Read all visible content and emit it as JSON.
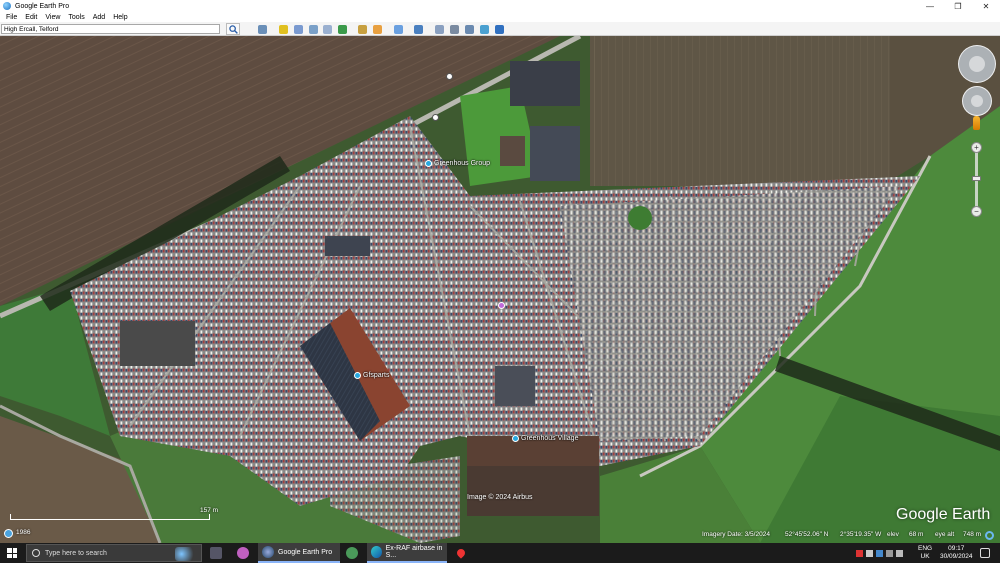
{
  "window": {
    "title": "Google Earth Pro",
    "controls": {
      "minimize": "—",
      "maximize": "❐",
      "close": "✕"
    }
  },
  "menu": [
    "File",
    "Edit",
    "View",
    "Tools",
    "Add",
    "Help"
  ],
  "search": {
    "value": "High Ercall, Telford"
  },
  "toolbar": {
    "icons": [
      "sidebar-icon",
      "placemark-icon",
      "polygon-icon",
      "path-icon",
      "image-overlay-icon",
      "record-tour-icon",
      "historical-imagery-icon",
      "sunlight-icon",
      "planets-icon",
      "ruler-icon",
      "email-icon",
      "print-icon",
      "save-image-icon",
      "view-in-maps-icon",
      "earth-icon"
    ],
    "colors": [
      "#6a8fb8",
      "#e0c020",
      "#7a9ad0",
      "#7aa0c8",
      "#9ab0d0",
      "#3a9a4a",
      "#c7a040",
      "#e8a040",
      "#6aa0e0",
      "#4a80c0",
      "#8aa0c0",
      "#7a8aa0",
      "#6a8ab0",
      "#4aa0d0",
      "#3070c0"
    ]
  },
  "map": {
    "places": {
      "greenhous_group": "Greenhous Group",
      "gfsparts": "Gfsparts",
      "greenhous_village": "Greenhous Village"
    },
    "scale": "157 m",
    "history_year": "1986",
    "copyright": "Image © 2024 Airbus",
    "logo": "Google Earth",
    "status": {
      "imagery_date": "Imagery Date: 3/5/2024",
      "lat": "52°45'52.06\" N",
      "lon": "2°35'19.35\" W",
      "elev_label": "elev",
      "elev": "68 m",
      "eye_label": "eye alt",
      "eye": "748 m"
    },
    "colors": {
      "field_brown": "#5c4a3e",
      "grass": "#4c8a3f",
      "lot": "#9a9a92",
      "roof_red": "#8a4430",
      "roof_dark": "#3a4450"
    }
  },
  "taskbar": {
    "search_placeholder": "Type here to search",
    "apps": {
      "earth": "Google Earth Pro",
      "edge": "Ex-RAF airbase in S..."
    },
    "tray": {
      "lang1": "ENG",
      "lang2": "UK",
      "time": "09:17",
      "date": "30/09/2024"
    }
  }
}
